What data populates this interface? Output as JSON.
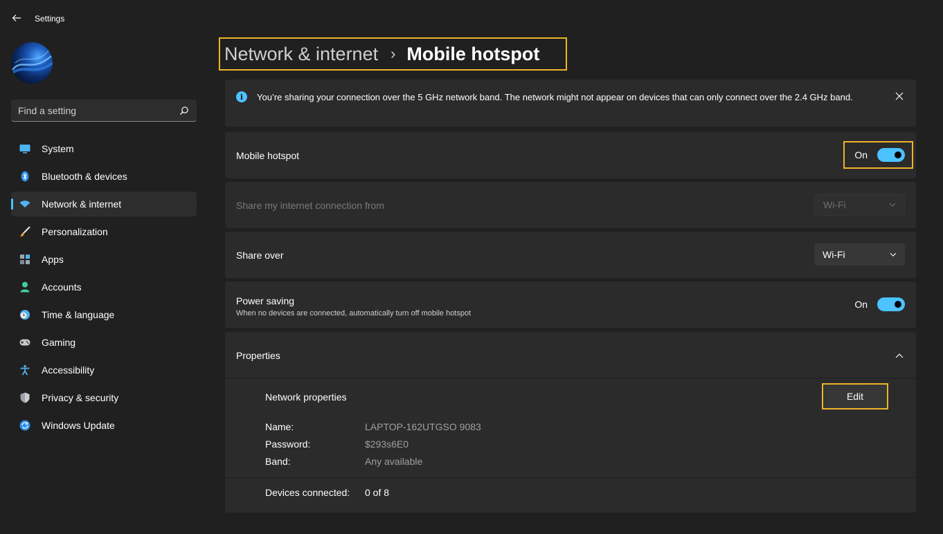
{
  "window": {
    "app_title": "Settings"
  },
  "search": {
    "placeholder": "Find a setting"
  },
  "sidebar": {
    "items": [
      {
        "label": "System",
        "icon": "display-icon",
        "active": false
      },
      {
        "label": "Bluetooth & devices",
        "icon": "bluetooth-icon",
        "active": false
      },
      {
        "label": "Network & internet",
        "icon": "wifi-icon",
        "active": true
      },
      {
        "label": "Personalization",
        "icon": "brush-icon",
        "active": false
      },
      {
        "label": "Apps",
        "icon": "apps-icon",
        "active": false
      },
      {
        "label": "Accounts",
        "icon": "person-icon",
        "active": false
      },
      {
        "label": "Time & language",
        "icon": "clock-globe-icon",
        "active": false
      },
      {
        "label": "Gaming",
        "icon": "gamepad-icon",
        "active": false
      },
      {
        "label": "Accessibility",
        "icon": "accessibility-icon",
        "active": false
      },
      {
        "label": "Privacy & security",
        "icon": "shield-icon",
        "active": false
      },
      {
        "label": "Windows Update",
        "icon": "update-icon",
        "active": false
      }
    ]
  },
  "breadcrumb": {
    "parent": "Network & internet",
    "separator": "›",
    "current": "Mobile hotspot"
  },
  "info_bar": {
    "text": "You’re sharing your connection over the 5 GHz network band. The network might not appear on devices that can only connect over the 2.4 GHz band."
  },
  "settings": {
    "mobile_hotspot": {
      "label": "Mobile hotspot",
      "state": "On",
      "enabled": true
    },
    "share_from": {
      "label": "Share my internet connection from",
      "value": "Wi-Fi",
      "disabled": true
    },
    "share_over": {
      "label": "Share over",
      "value": "Wi-Fi"
    },
    "power_saving": {
      "label": "Power saving",
      "description": "When no devices are connected, automatically turn off mobile hotspot",
      "state": "On",
      "enabled": true
    }
  },
  "properties": {
    "title": "Properties",
    "network_properties_label": "Network properties",
    "edit_label": "Edit",
    "name_key": "Name:",
    "name_value": "LAPTOP-162UTGSO 9083",
    "password_key": "Password:",
    "password_value": "$293s6E0",
    "band_key": "Band:",
    "band_value": "Any available",
    "devices_key": "Devices connected:",
    "devices_value": "0 of 8"
  },
  "colors": {
    "accent": "#4cc2ff",
    "highlight": "#f0b429",
    "background": "#202020",
    "card": "#2b2b2b"
  }
}
